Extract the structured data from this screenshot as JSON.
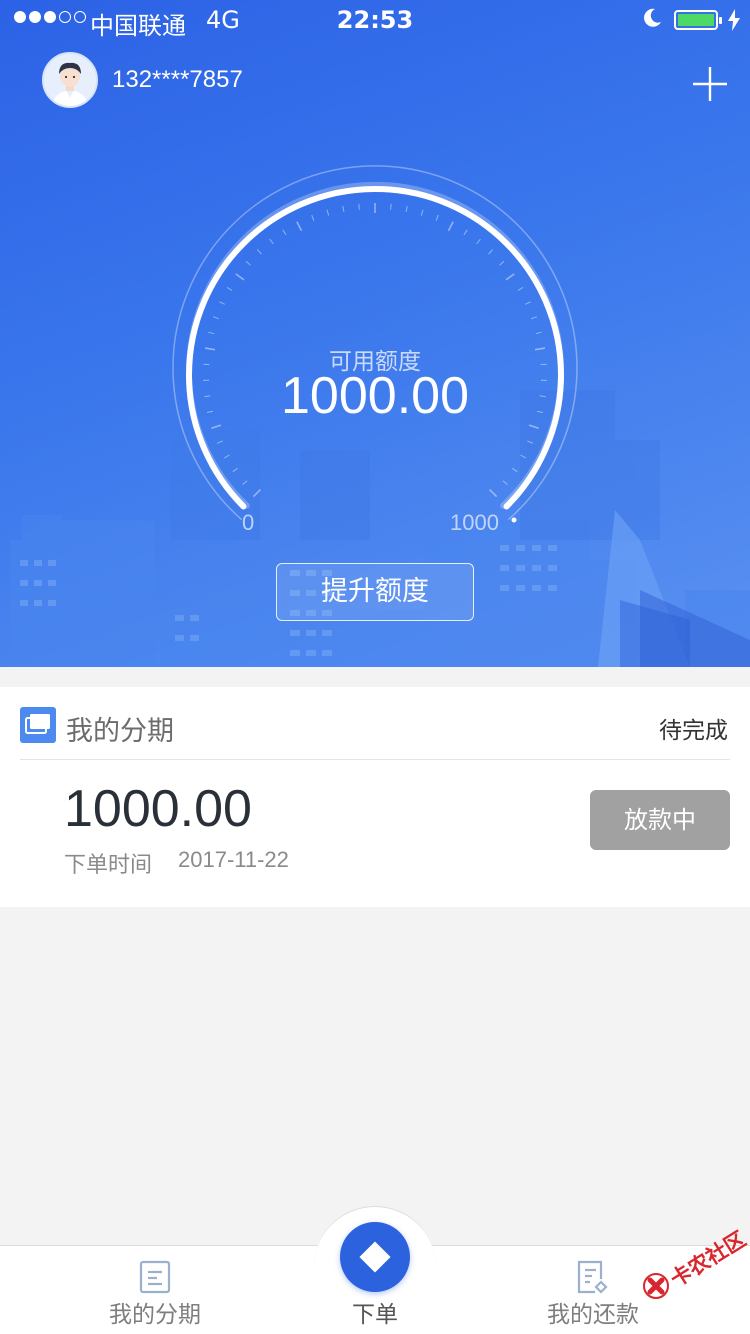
{
  "status_bar": {
    "signal_full": 3,
    "signal_total": 5,
    "carrier": "中国联通",
    "network": "4G",
    "time": "22:53",
    "battery_color": "#4cd964"
  },
  "header": {
    "phone": "132****7857",
    "avatar_icon": "user-avatar-icon",
    "add_icon": "plus-icon"
  },
  "gauge": {
    "label": "可用额度",
    "value": "1000.00",
    "min_label": "0",
    "max_label": "1000",
    "fill_fraction": 1.0
  },
  "raise_button": {
    "label": "提升额度"
  },
  "installments": {
    "title": "我的分期",
    "icon": "cards-icon",
    "status": "待完成",
    "order": {
      "amount": "1000.00",
      "time_label": "下单时间",
      "time_value": "2017-11-22",
      "status_label": "放款中"
    }
  },
  "tabbar": {
    "left": {
      "label": "我的分期",
      "icon": "document-icon"
    },
    "center": {
      "label": "下单",
      "icon": "diamond-icon"
    },
    "right": {
      "label": "我的还款",
      "icon": "document-edit-icon"
    }
  },
  "watermark": {
    "text": "卡农社区"
  },
  "colors": {
    "primary": "#2d62de",
    "hero_start": "#2c62e6",
    "hero_end": "#5a91f1",
    "status_button": "#a1a1a1",
    "background": "#f3f3f3"
  }
}
